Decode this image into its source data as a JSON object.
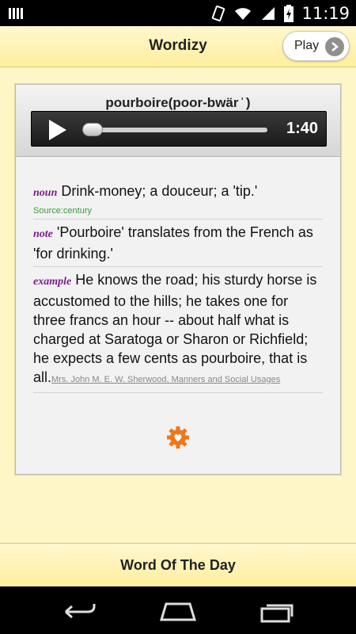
{
  "statusbar": {
    "time": "11:19"
  },
  "header": {
    "title": "Wordizy",
    "play_label": "Play"
  },
  "word": {
    "headword": "pourboire(poor-bwär ̍ )"
  },
  "player": {
    "time": "1:40",
    "progress": 0.05
  },
  "definitions": [
    {
      "pos": "noun",
      "text": "Drink-money; a douceur; a 'tip.'",
      "source": "Source:century"
    },
    {
      "pos": "note",
      "text": "'Pourboire' translates from the French as 'for drinking.'"
    },
    {
      "pos": "example",
      "text": "He knows the road; his sturdy horse is accustomed to the hills; he takes one for three francs an hour -- about half what is charged at Saratoga or Sharon or Richfield; he expects a few cents as pourboire, that is all.",
      "attribution": "Mrs. John M. E. W. Sherwood, Manners and Social Usages"
    }
  ],
  "footer": {
    "label": "Word Of The Day"
  },
  "colors": {
    "accent": "#f07818",
    "pos": "#7d1c8c",
    "source": "#3a9a3a",
    "header_bg": "#ffef9e"
  },
  "icons": {
    "play": "play-icon",
    "chevron": "chevron-right-icon",
    "settings": "gear-icon"
  }
}
